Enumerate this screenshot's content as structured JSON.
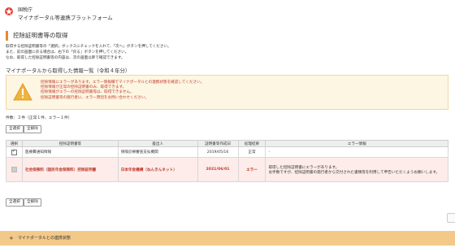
{
  "header": {
    "agency": "国税庁",
    "system_name": "マイナポータル等連携プラットフォーム"
  },
  "section_title": "控除証明書等の取得",
  "description": [
    "取得する控除証明書等の「選択」ボックスにチェックを入れて、「次へ」ボタンを押してください。",
    "また、前の画面に戻る場合は、右下の「戻る」ボタンを押してください。",
    "なお、取得した控除証明書等の内容は、次の画面以降で確認できます。"
  ],
  "list_title": "マイナポータルから取得した情報一覧（令和４年分）",
  "warning_lines": [
    "控除情報にエラーがあります。エラー情報欄でマイナポータルとの連携状態を確認してください。",
    "控除情報が正常の控除証明書のみ、取得できます。",
    "控除情報がエラーの控除証明書等は、取得できません。",
    "控除証明書等の発行者に、エラー原因をお問い合わせください。"
  ],
  "count_text": "件数：２件（正常１件、エラー１件）",
  "buttons": {
    "select_all": "全選択",
    "deselect_all": "全解除"
  },
  "table": {
    "headers": [
      "選択",
      "控除証明書等",
      "差出人",
      "証明書等作成日",
      "処理結果",
      "エラー情報"
    ],
    "rows": [
      {
        "selected": true,
        "name": "医療費通知情報",
        "issuer": "保険診療審査支払機関",
        "date": "2019/05/16",
        "status": "正常",
        "error": "-"
      },
      {
        "selected": false,
        "name": "社会保険料（国民年金保険料）控除証明書",
        "issuer": "日本年金機構（ねんきんネット）",
        "date": "2021/06/01",
        "status": "エラー",
        "error_lines": [
          "取得した控除証明書にエラーがあります。",
          "お手数ですが、控除証明書の発行者から交付された書類等を利用して申告いただくようお願いします。"
        ]
      }
    ]
  },
  "footer": {
    "plus": "+",
    "label": "マイナポータルとの連携状態"
  },
  "colors": {
    "accent": "#e8892c",
    "error": "#c0392b",
    "warning_bg": "#fdf6e3",
    "footer_bg": "#f3c98a"
  }
}
